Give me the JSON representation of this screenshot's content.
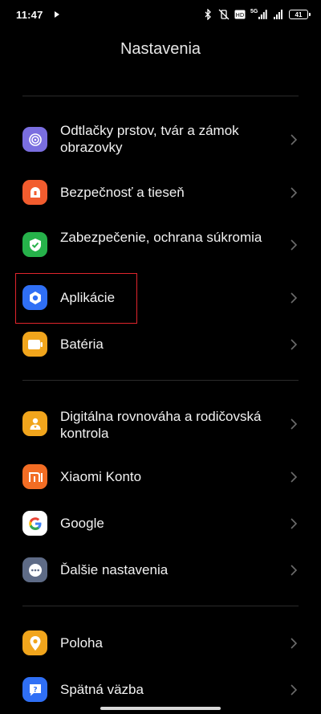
{
  "statusbar": {
    "time": "11:47",
    "battery": "41",
    "network_label": "5G"
  },
  "header": {
    "title": "Nastavenia"
  },
  "items": [
    {
      "label": "Odtlačky prstov, tvár a zámok obrazovky",
      "icon": "fingerprint-icon",
      "color": "#7a6ee0"
    },
    {
      "label": "Bezpečnosť a tieseň",
      "icon": "emergency-icon",
      "color": "#f25c2e"
    },
    {
      "label": "Zabezpečenie, ochrana súkromia",
      "icon": "shield-check-icon",
      "color": "#26b14a"
    },
    {
      "label": "Aplikácie",
      "icon": "apps-gear-icon",
      "color": "#2f6ff5"
    },
    {
      "label": "Batéria",
      "icon": "battery-icon",
      "color": "#f1a51c"
    },
    {
      "label": "Digitálna rovnováha a rodičovská kontrola",
      "icon": "parental-icon",
      "color": "#f1a51c"
    },
    {
      "label": "Xiaomi Konto",
      "icon": "xiaomi-icon",
      "color": "#f36d24"
    },
    {
      "label": "Google",
      "icon": "google-icon",
      "color": "#ffffff"
    },
    {
      "label": "Ďalšie nastavenia",
      "icon": "more-dots-icon",
      "color": "#5e6b86"
    },
    {
      "label": "Poloha",
      "icon": "location-pin-icon",
      "color": "#f1a51c"
    },
    {
      "label": "Spätná väzba",
      "icon": "feedback-icon",
      "color": "#2f6ff5"
    }
  ]
}
